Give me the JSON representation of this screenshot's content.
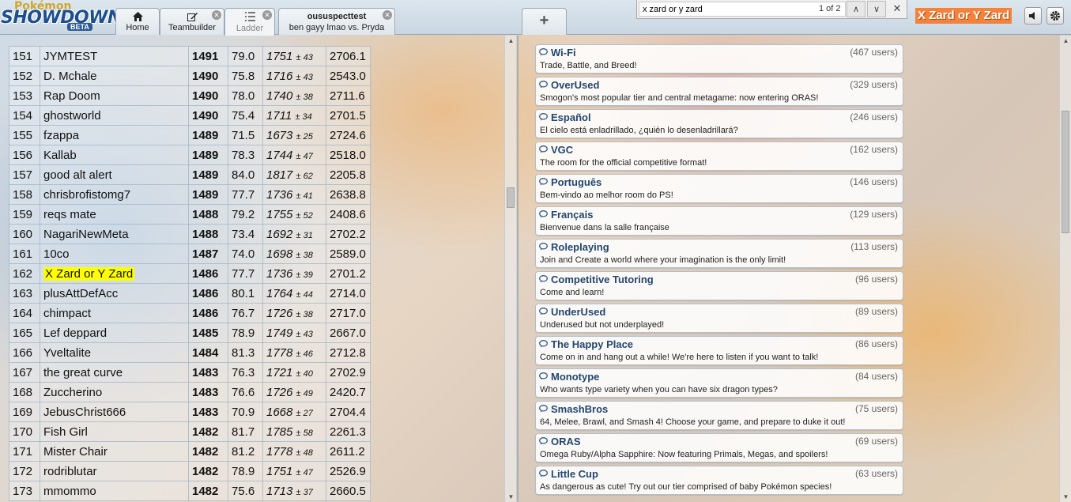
{
  "header": {
    "logo_top": "Pokémon",
    "logo_main": "SHOWDOWN",
    "logo_beta": "BETA",
    "tabs": [
      {
        "label": "Home",
        "icon": "home-icon"
      },
      {
        "label": "Teambuilder",
        "icon": "edit-icon"
      },
      {
        "label": "Ladder",
        "icon": "list-icon"
      },
      {
        "title": "oususpecttest",
        "label": "ben gayy lmao vs. Pryda"
      }
    ],
    "new_tab": "+",
    "username": "X Zard or Y Zard"
  },
  "find": {
    "query": "x zard or y zard",
    "count": "1 of 2",
    "up": "∧",
    "down": "∨",
    "close": "✕"
  },
  "ladder": {
    "rows": [
      {
        "rank": "151",
        "name": "JYMTEST",
        "elo": "1491",
        "gxe": "79.0",
        "glicko": "1751",
        "dev": "43",
        "cov": "2706.1"
      },
      {
        "rank": "152",
        "name": "D. Mchale",
        "elo": "1490",
        "gxe": "75.8",
        "glicko": "1716",
        "dev": "43",
        "cov": "2543.0"
      },
      {
        "rank": "153",
        "name": "Rap Doom",
        "elo": "1490",
        "gxe": "78.0",
        "glicko": "1740",
        "dev": "38",
        "cov": "2711.6"
      },
      {
        "rank": "154",
        "name": "ghostworld",
        "elo": "1490",
        "gxe": "75.4",
        "glicko": "1711",
        "dev": "34",
        "cov": "2701.5"
      },
      {
        "rank": "155",
        "name": "fzappa",
        "elo": "1489",
        "gxe": "71.5",
        "glicko": "1673",
        "dev": "25",
        "cov": "2724.6"
      },
      {
        "rank": "156",
        "name": "Kallab",
        "elo": "1489",
        "gxe": "78.3",
        "glicko": "1744",
        "dev": "47",
        "cov": "2518.0"
      },
      {
        "rank": "157",
        "name": "good alt alert",
        "elo": "1489",
        "gxe": "84.0",
        "glicko": "1817",
        "dev": "62",
        "cov": "2205.8"
      },
      {
        "rank": "158",
        "name": "chrisbrofistomg7",
        "elo": "1489",
        "gxe": "77.7",
        "glicko": "1736",
        "dev": "41",
        "cov": "2638.8"
      },
      {
        "rank": "159",
        "name": "reqs mate",
        "elo": "1488",
        "gxe": "79.2",
        "glicko": "1755",
        "dev": "52",
        "cov": "2408.6"
      },
      {
        "rank": "160",
        "name": "NagariNewMeta",
        "elo": "1488",
        "gxe": "73.4",
        "glicko": "1692",
        "dev": "31",
        "cov": "2702.2"
      },
      {
        "rank": "161",
        "name": "10co",
        "elo": "1487",
        "gxe": "74.0",
        "glicko": "1698",
        "dev": "38",
        "cov": "2589.0"
      },
      {
        "rank": "162",
        "name": "X Zard or Y Zard",
        "elo": "1486",
        "gxe": "77.7",
        "glicko": "1736",
        "dev": "39",
        "cov": "2701.2",
        "highlight": true
      },
      {
        "rank": "163",
        "name": "plusAttDefAcc",
        "elo": "1486",
        "gxe": "80.1",
        "glicko": "1764",
        "dev": "44",
        "cov": "2714.0"
      },
      {
        "rank": "164",
        "name": "chimpact",
        "elo": "1486",
        "gxe": "76.7",
        "glicko": "1726",
        "dev": "38",
        "cov": "2717.0"
      },
      {
        "rank": "165",
        "name": "Lef deppard",
        "elo": "1485",
        "gxe": "78.9",
        "glicko": "1749",
        "dev": "43",
        "cov": "2667.0"
      },
      {
        "rank": "166",
        "name": "Yveltalite",
        "elo": "1484",
        "gxe": "81.3",
        "glicko": "1778",
        "dev": "46",
        "cov": "2712.8"
      },
      {
        "rank": "167",
        "name": "the great curve",
        "elo": "1483",
        "gxe": "76.3",
        "glicko": "1721",
        "dev": "40",
        "cov": "2702.9"
      },
      {
        "rank": "168",
        "name": "Zuccherino",
        "elo": "1483",
        "gxe": "76.6",
        "glicko": "1726",
        "dev": "49",
        "cov": "2420.7"
      },
      {
        "rank": "169",
        "name": "JebusChrist666",
        "elo": "1483",
        "gxe": "70.9",
        "glicko": "1668",
        "dev": "27",
        "cov": "2704.4"
      },
      {
        "rank": "170",
        "name": "Fish Girl",
        "elo": "1482",
        "gxe": "81.7",
        "glicko": "1785",
        "dev": "58",
        "cov": "2261.3"
      },
      {
        "rank": "171",
        "name": "Mister Chair",
        "elo": "1482",
        "gxe": "81.2",
        "glicko": "1778",
        "dev": "48",
        "cov": "2611.2"
      },
      {
        "rank": "172",
        "name": "rodriblutar",
        "elo": "1482",
        "gxe": "78.9",
        "glicko": "1751",
        "dev": "47",
        "cov": "2526.9"
      },
      {
        "rank": "173",
        "name": "mmommo",
        "elo": "1482",
        "gxe": "75.6",
        "glicko": "1713",
        "dev": "37",
        "cov": "2660.5"
      }
    ]
  },
  "rooms": [
    {
      "name": "Wi-Fi",
      "users": "(467 users)",
      "desc": "Trade, Battle, and Breed!"
    },
    {
      "name": "OverUsed",
      "users": "(329 users)",
      "desc": "Smogon's most popular tier and central metagame: now entering ORAS!"
    },
    {
      "name": "Español",
      "users": "(246 users)",
      "desc": "El cielo está enladrillado, ¿quién lo desenladrillará?"
    },
    {
      "name": "VGC",
      "users": "(162 users)",
      "desc": "The room for the official competitive format!"
    },
    {
      "name": "Português",
      "users": "(146 users)",
      "desc": "Bem-vindo ao melhor room do PS!"
    },
    {
      "name": "Français",
      "users": "(129 users)",
      "desc": "Bienvenue dans la salle française"
    },
    {
      "name": "Roleplaying",
      "users": "(113 users)",
      "desc": "Join and Create a world where your imagination is the only limit!"
    },
    {
      "name": "Competitive Tutoring",
      "users": "(96 users)",
      "desc": "Come and learn!"
    },
    {
      "name": "UnderUsed",
      "users": "(89 users)",
      "desc": "Underused but not underplayed!"
    },
    {
      "name": "The Happy Place",
      "users": "(86 users)",
      "desc": "Come on in and hang out a while! We're here to listen if you want to talk!"
    },
    {
      "name": "Monotype",
      "users": "(84 users)",
      "desc": "Who wants type variety when you can have six dragon types?"
    },
    {
      "name": "SmashBros",
      "users": "(75 users)",
      "desc": "64, Melee, Brawl, and Smash 4! Choose your game, and prepare to duke it out!"
    },
    {
      "name": "ORAS",
      "users": "(69 users)",
      "desc": "Omega Ruby/Alpha Sapphire: Now featuring Primals, Megas, and spoilers!"
    },
    {
      "name": "Little Cup",
      "users": "(63 users)",
      "desc": "As dangerous as cute! Try out our tier comprised of baby Pokémon species!"
    }
  ],
  "colors": {
    "highlight": "#ffff00",
    "user_badge": "#f5823b",
    "room_name": "#23466e"
  },
  "icons": {
    "home": "home-icon",
    "teambuilder": "edit-icon",
    "ladder": "list-icon",
    "sound": "speaker-icon",
    "settings": "gear-icon",
    "room": "chat-bubble-icon"
  }
}
